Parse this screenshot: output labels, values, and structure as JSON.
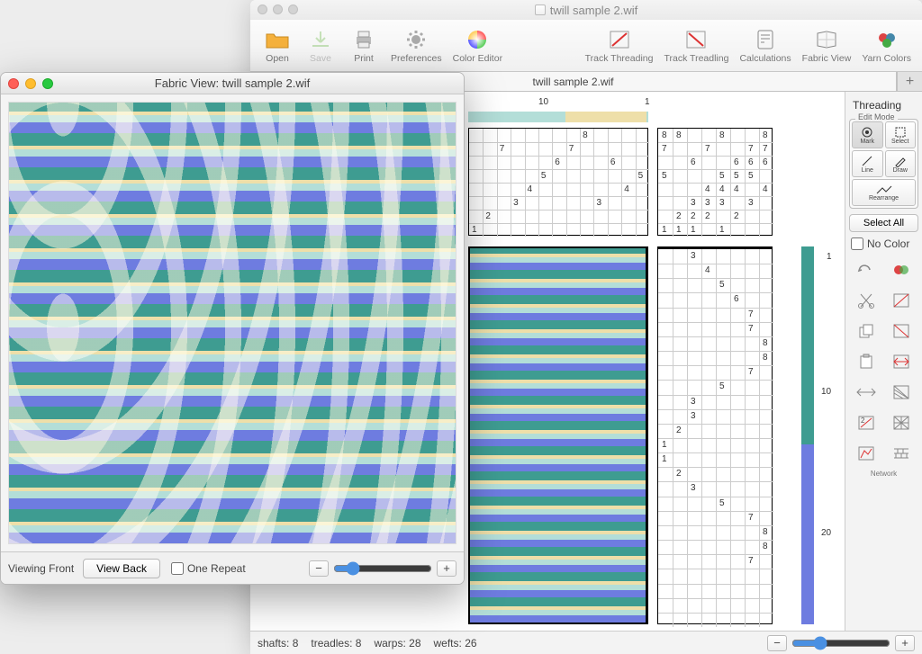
{
  "main": {
    "window_title": "twill sample 2.wif",
    "tab_title": "twill sample 2.wif"
  },
  "toolbar": {
    "open": "Open",
    "save": "Save",
    "print": "Print",
    "preferences": "Preferences",
    "color_editor": "Color Editor",
    "track_threading": "Track Threading",
    "track_treadling": "Track Treadling",
    "calculations": "Calculations",
    "fabric_view": "Fabric View",
    "yarn_colors": "Yarn Colors"
  },
  "side": {
    "heading": "Threading",
    "edit_mode_label": "Edit Mode",
    "mode": {
      "mark": "Mark",
      "select": "Select",
      "line": "Line",
      "draw": "Draw",
      "rearrange": "Rearrange"
    },
    "select_all": "Select All",
    "no_color": "No Color",
    "tool_network": "Network"
  },
  "draft": {
    "top_ruler": {
      "n10": "10",
      "n1": "1"
    },
    "threading_rows": [
      "8",
      "7",
      "6",
      "5",
      "4",
      "3",
      "2",
      "1"
    ],
    "threading_cells": [
      {
        "r": 1,
        "c": 5,
        "v": "8"
      },
      {
        "r": 2,
        "c": 6,
        "v": "7"
      },
      {
        "r": 2,
        "c": 11,
        "v": "7"
      },
      {
        "r": 3,
        "c": 3,
        "v": "6"
      },
      {
        "r": 3,
        "c": 7,
        "v": "6"
      },
      {
        "r": 4,
        "c": 1,
        "v": "5"
      },
      {
        "r": 4,
        "c": 8,
        "v": "5"
      },
      {
        "r": 5,
        "c": 2,
        "v": "4"
      },
      {
        "r": 5,
        "c": 9,
        "v": "4"
      },
      {
        "r": 6,
        "c": 4,
        "v": "3"
      },
      {
        "r": 6,
        "c": 10,
        "v": "3"
      },
      {
        "r": 7,
        "c": 12,
        "v": "2"
      },
      {
        "r": 8,
        "c": 13,
        "v": "1"
      }
    ],
    "tieup_cells": [
      {
        "r": 1,
        "c": 1,
        "v": "8"
      },
      {
        "r": 1,
        "c": 2,
        "v": "8"
      },
      {
        "r": 1,
        "c": 5,
        "v": "8"
      },
      {
        "r": 1,
        "c": 8,
        "v": "8"
      },
      {
        "r": 2,
        "c": 1,
        "v": "7"
      },
      {
        "r": 2,
        "c": 4,
        "v": "7"
      },
      {
        "r": 2,
        "c": 7,
        "v": "7"
      },
      {
        "r": 2,
        "c": 8,
        "v": "7"
      },
      {
        "r": 3,
        "c": 3,
        "v": "6"
      },
      {
        "r": 3,
        "c": 6,
        "v": "6"
      },
      {
        "r": 3,
        "c": 7,
        "v": "6"
      },
      {
        "r": 3,
        "c": 8,
        "v": "6"
      },
      {
        "r": 4,
        "c": 1,
        "v": "5"
      },
      {
        "r": 4,
        "c": 5,
        "v": "5"
      },
      {
        "r": 4,
        "c": 6,
        "v": "5"
      },
      {
        "r": 4,
        "c": 7,
        "v": "5"
      },
      {
        "r": 5,
        "c": 4,
        "v": "4"
      },
      {
        "r": 5,
        "c": 5,
        "v": "4"
      },
      {
        "r": 5,
        "c": 6,
        "v": "4"
      },
      {
        "r": 5,
        "c": 8,
        "v": "4"
      },
      {
        "r": 6,
        "c": 3,
        "v": "3"
      },
      {
        "r": 6,
        "c": 4,
        "v": "3"
      },
      {
        "r": 6,
        "c": 5,
        "v": "3"
      },
      {
        "r": 6,
        "c": 7,
        "v": "3"
      },
      {
        "r": 7,
        "c": 2,
        "v": "2"
      },
      {
        "r": 7,
        "c": 3,
        "v": "2"
      },
      {
        "r": 7,
        "c": 4,
        "v": "2"
      },
      {
        "r": 7,
        "c": 6,
        "v": "2"
      },
      {
        "r": 8,
        "c": 1,
        "v": "1"
      },
      {
        "r": 8,
        "c": 2,
        "v": "1"
      },
      {
        "r": 8,
        "c": 3,
        "v": "1"
      },
      {
        "r": 8,
        "c": 5,
        "v": "1"
      }
    ],
    "treadling_sequence": [
      {
        "row": 1,
        "t": "3"
      },
      {
        "row": 2,
        "t": "4"
      },
      {
        "row": 3,
        "t": "5"
      },
      {
        "row": 4,
        "t": "6"
      },
      {
        "row": 5,
        "t": "7"
      },
      {
        "row": 6,
        "t": "7"
      },
      {
        "row": 7,
        "t": "8"
      },
      {
        "row": 8,
        "t": "8"
      },
      {
        "row": 9,
        "t": "7"
      },
      {
        "row": 10,
        "t": "5"
      },
      {
        "row": 11,
        "t": "3"
      },
      {
        "row": 12,
        "t": "3"
      },
      {
        "row": 13,
        "t": "2"
      },
      {
        "row": 14,
        "t": "1"
      },
      {
        "row": 15,
        "t": "1"
      },
      {
        "row": 16,
        "t": "2"
      },
      {
        "row": 17,
        "t": "3"
      },
      {
        "row": 18,
        "t": "5"
      },
      {
        "row": 19,
        "t": "7"
      },
      {
        "row": 20,
        "t": "8"
      },
      {
        "row": 21,
        "t": "8"
      },
      {
        "row": 22,
        "t": "7"
      }
    ],
    "right_ruler": {
      "n1": "1",
      "n10": "10",
      "n20": "20"
    }
  },
  "status": {
    "shafts_label": "shafts:",
    "shafts_value": "8",
    "treadles_label": "treadles:",
    "treadles_value": "8",
    "warps_label": "warps:",
    "warps_value": "28",
    "wefts_label": "wefts:",
    "wefts_value": "26"
  },
  "fabric_view": {
    "title": "Fabric View: twill sample 2.wif",
    "viewing_front": "Viewing Front",
    "view_back": "View Back",
    "one_repeat": "One Repeat"
  },
  "colors": {
    "teal_dark": "#3e9c91",
    "teal_light": "#b3ded8",
    "cream": "#eedfa9",
    "periwinkle": "#6e7ce0"
  }
}
